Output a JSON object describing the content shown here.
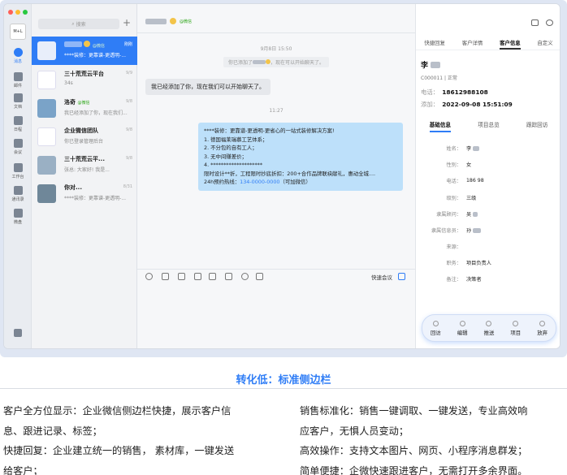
{
  "rail": {
    "items": [
      {
        "label": "消息"
      },
      {
        "label": "邮件"
      },
      {
        "label": "文档"
      },
      {
        "label": "日程"
      },
      {
        "label": "会议"
      },
      {
        "label": "工作台"
      },
      {
        "label": "通讯录"
      },
      {
        "label": "微盘"
      }
    ]
  },
  "list": {
    "search_placeholder": "搜索",
    "chats": [
      {
        "name": "",
        "tag": "@微信",
        "time": "刚刚",
        "preview": "****装修：更靠谱-更透明-..."
      },
      {
        "name": "三十荒荒云平台",
        "tag": "",
        "time": "9/9",
        "preview": "34s"
      },
      {
        "name": "洛奇",
        "tag": "@微信",
        "time": "9/8",
        "preview": "我已经添加了你，现在我们..."
      },
      {
        "name": "企业微信团队",
        "tag": "",
        "time": "9/8",
        "preview": "你已登录管理后台"
      },
      {
        "name": "三十荒荒云平...",
        "tag": "",
        "time": "9/8",
        "preview": "张总: 大家好! 我是..."
      },
      {
        "name": "你对...",
        "tag": "",
        "time": "8/31",
        "preview": "****装修：更靠谱-更透明-..."
      }
    ]
  },
  "chat": {
    "header_tag": "@微信",
    "sys_time1": "9月8日 15:50",
    "sys_msg": "，现在可以开始聊天了。",
    "sys_msg_prefix": "你已添加了",
    "left_msg": "我已经添加了你，现在我们可以开始聊天了。",
    "sys_time2": "11:27",
    "right_lines": [
      "****装修：更靠谱-更透明-更省心的一站式装修解决方案!",
      "1. 德国福莱瑞慕工艺体系；",
      "2. 不分包的自有工人；",
      "3. 无中间赚差价；",
      "4. ********************",
      "限时设计**折，工程限时抄底折扣：200+合作品牌联袂献礼，惠动全城...."
    ],
    "right_hotline_prefix": "24h预约热线：",
    "right_hotline": "134-0000-0000",
    "right_hotline_suffix": "（可加微信）",
    "meeting_label": "快速会议"
  },
  "side": {
    "tabs": [
      "快捷回复",
      "客户详情",
      "客户信息",
      "自定义"
    ],
    "active_tab": 2,
    "name": "李",
    "cust_id": "C000011 | 正常",
    "phone_label": "电话：",
    "phone": "18612988108",
    "added_label": "添加：",
    "added": "2022-09-08 15:51:09",
    "info_tabs": [
      "基础信息",
      "项目总览",
      "跟踪回访"
    ],
    "info_rows": [
      {
        "k": "姓名：",
        "v": "李"
      },
      {
        "k": "性别：",
        "v": "女"
      },
      {
        "k": "电话：",
        "v": "186        98"
      },
      {
        "k": "级别：",
        "v": "三级"
      },
      {
        "k": "隶属顾问：",
        "v": "吴"
      },
      {
        "k": "隶属信息员：",
        "v": "孙"
      },
      {
        "k": "来源：",
        "v": ""
      },
      {
        "k": "职务：",
        "v": "项目负责人"
      },
      {
        "k": "备注：",
        "v": "决策者"
      }
    ],
    "actions": [
      "回访",
      "编辑",
      "推送",
      "项目",
      "放弃"
    ]
  },
  "caption": {
    "title": "转化低：标准侧边栏",
    "left": [
      "客户全方位显示：企业微信侧边栏快捷，展示客户信",
      "息、跟进记录、标签；",
      "快捷回复：企业建立统一的销售，  素材库，一键发送",
      "给客户；"
    ],
    "right": [
      "销售标准化：销售一键调取、一键发送，专业高效响",
      "应客户，无惧人员变动；",
      "高效操作：支持文本图片、网页、小程序消息群发；",
      "简单便捷：企微快速跟进客户，无需打开多余界面。"
    ]
  },
  "colors": {
    "accent": "#2f7df6",
    "bubble": "#bde0fa",
    "wechat_green": "#2aa515"
  }
}
